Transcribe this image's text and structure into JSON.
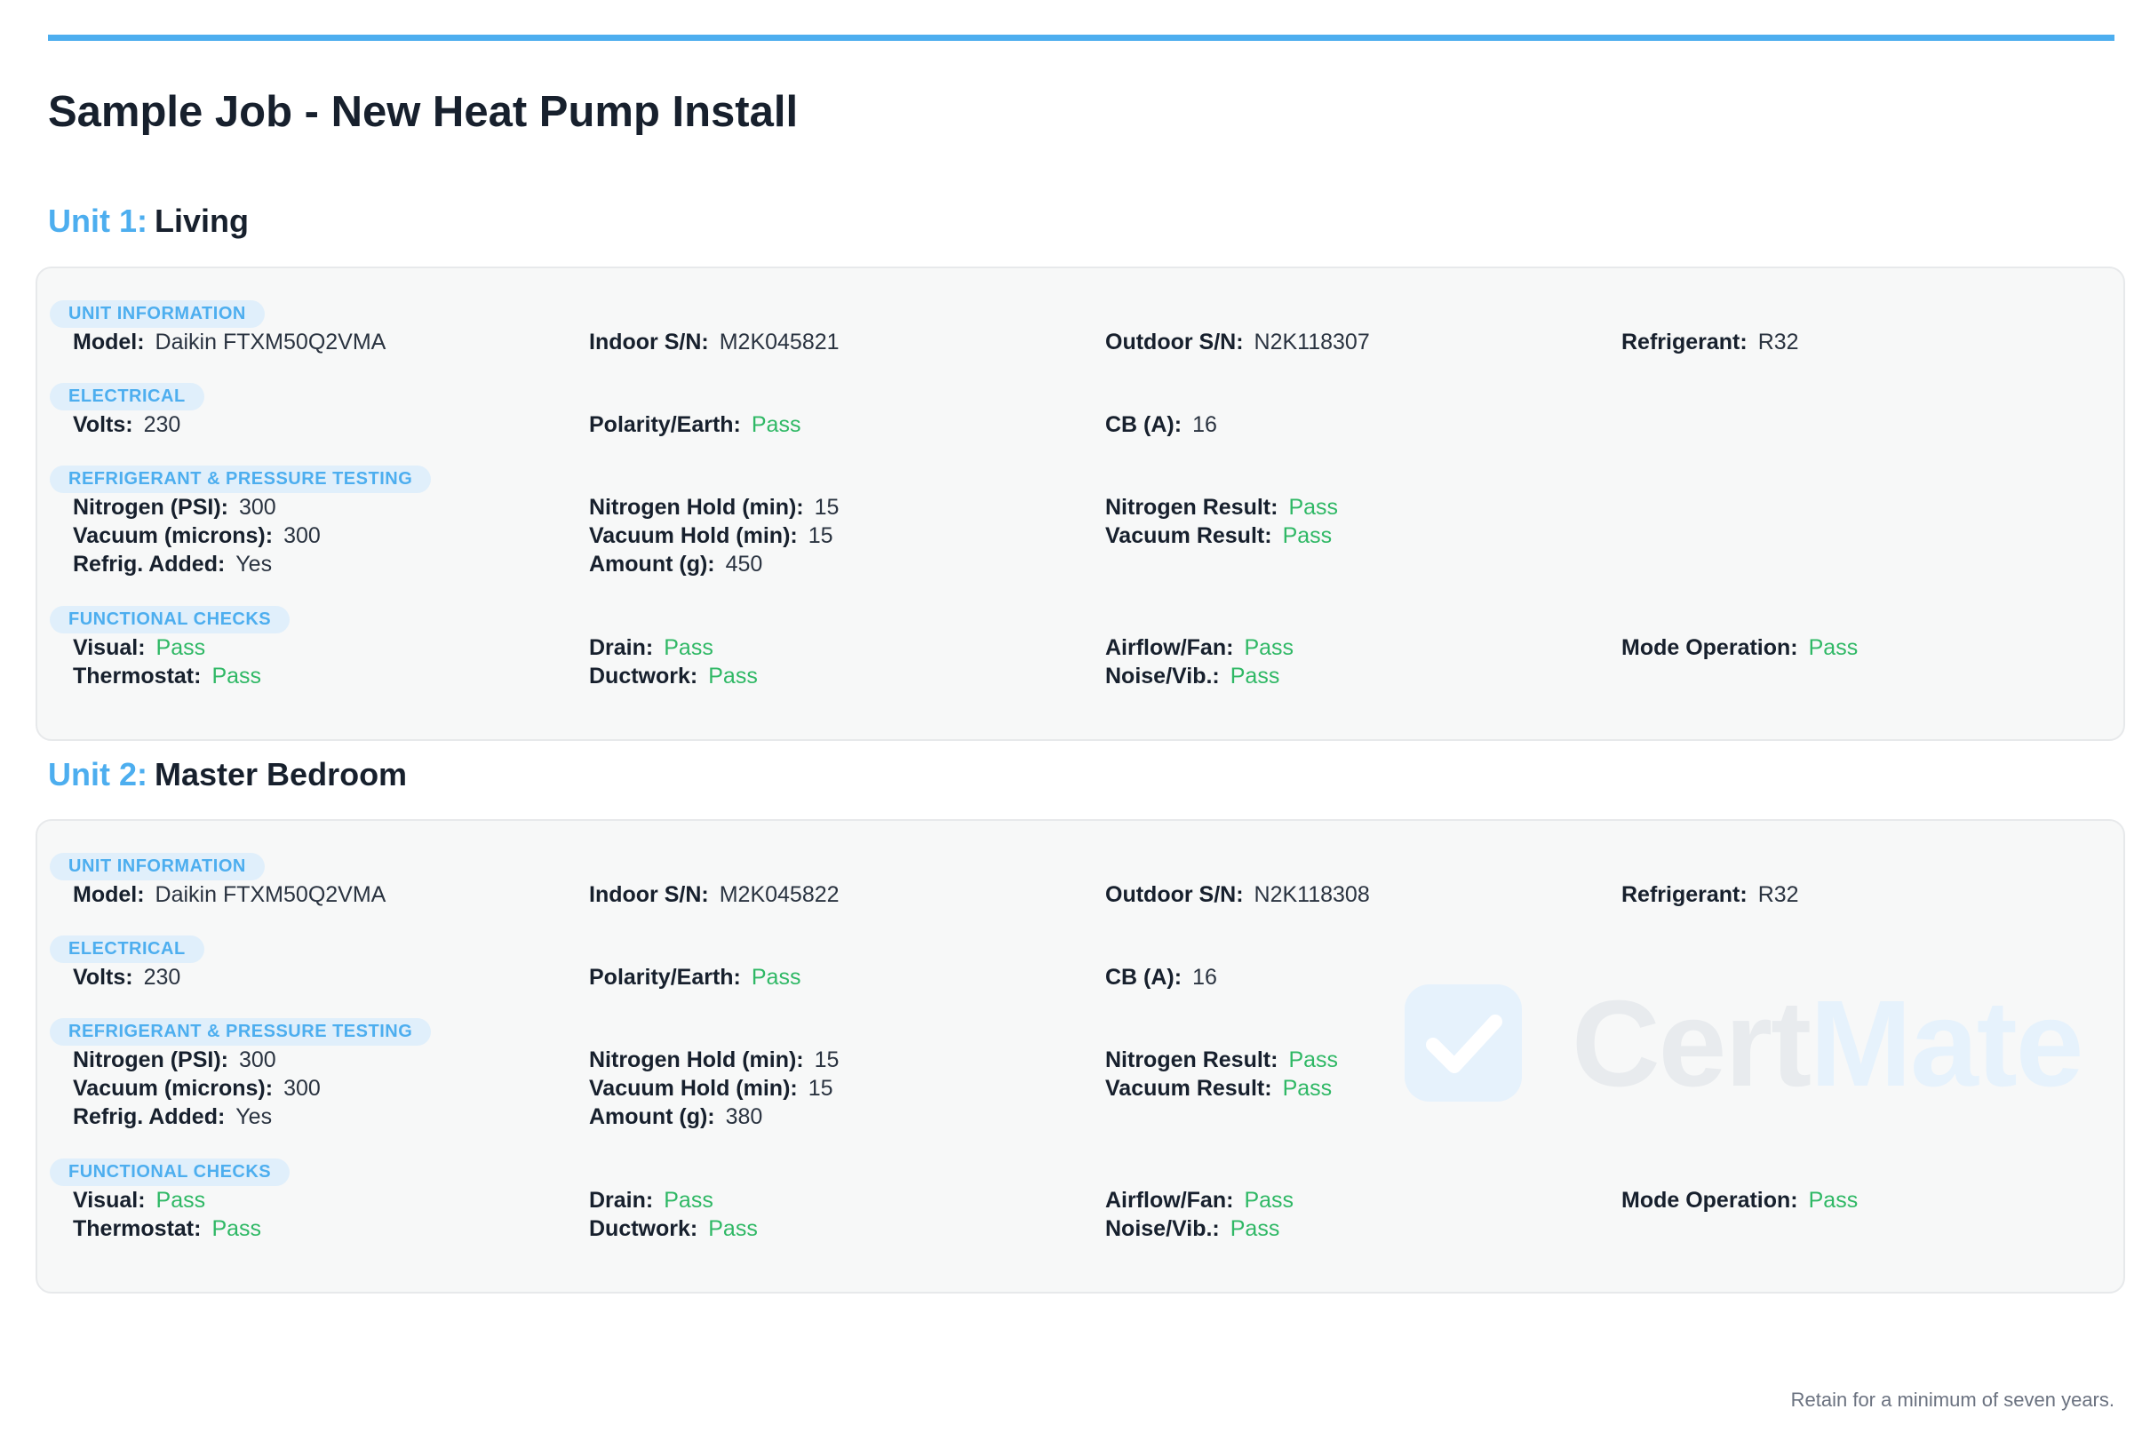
{
  "page": {
    "title": "Sample Job - New Heat Pump Install",
    "footer_note": "Retain for a minimum of seven years.",
    "watermark": {
      "cert": "Cert",
      "mate": "Mate",
      "icon": "check-badge-icon"
    }
  },
  "colors": {
    "accent": "#4daeef",
    "pass": "#2fb865",
    "pill_bg": "#e0effb",
    "card_bg": "#f7f8f8"
  },
  "section_titles": {
    "unit_info": "UNIT INFORMATION",
    "electrical": "ELECTRICAL",
    "refrigerant": "REFRIGERANT & PRESSURE TESTING",
    "functional": "FUNCTIONAL CHECKS"
  },
  "labels": {
    "model": "Model:",
    "indoor_sn": "Indoor S/N:",
    "outdoor_sn": "Outdoor S/N:",
    "refrigerant": "Refrigerant:",
    "volts": "Volts:",
    "polarity": "Polarity/Earth:",
    "cb": "CB (A):",
    "nitrogen_psi": "Nitrogen (PSI):",
    "vacuum_microns": "Vacuum (microns):",
    "refrig_added": "Refrig. Added:",
    "nitrogen_hold": "Nitrogen Hold (min):",
    "vacuum_hold": "Vacuum Hold (min):",
    "amount": "Amount (g):",
    "nitrogen_result": "Nitrogen Result:",
    "vacuum_result": "Vacuum Result:",
    "visual": "Visual:",
    "thermostat": "Thermostat:",
    "drain": "Drain:",
    "ductwork": "Ductwork:",
    "airflow": "Airflow/Fan:",
    "noise": "Noise/Vib.:",
    "mode_operation": "Mode Operation:"
  },
  "units": [
    {
      "label": "Unit 1:",
      "name": "Living",
      "model": "Daikin FTXM50Q2VMA",
      "indoor_sn": "M2K045821",
      "outdoor_sn": "N2K118307",
      "refrigerant": "R32",
      "volts": "230",
      "polarity": "Pass",
      "cb": "16",
      "nitrogen_psi": "300",
      "vacuum_microns": "300",
      "refrig_added": "Yes",
      "nitrogen_hold": "15",
      "vacuum_hold": "15",
      "amount": "450",
      "nitrogen_result": "Pass",
      "vacuum_result": "Pass",
      "visual": "Pass",
      "thermostat": "Pass",
      "drain": "Pass",
      "ductwork": "Pass",
      "airflow": "Pass",
      "noise": "Pass",
      "mode_operation": "Pass"
    },
    {
      "label": "Unit 2:",
      "name": "Master Bedroom",
      "model": "Daikin FTXM50Q2VMA",
      "indoor_sn": "M2K045822",
      "outdoor_sn": "N2K118308",
      "refrigerant": "R32",
      "volts": "230",
      "polarity": "Pass",
      "cb": "16",
      "nitrogen_psi": "300",
      "vacuum_microns": "300",
      "refrig_added": "Yes",
      "nitrogen_hold": "15",
      "vacuum_hold": "15",
      "amount": "380",
      "nitrogen_result": "Pass",
      "vacuum_result": "Pass",
      "visual": "Pass",
      "thermostat": "Pass",
      "drain": "Pass",
      "ductwork": "Pass",
      "airflow": "Pass",
      "noise": "Pass",
      "mode_operation": "Pass"
    }
  ]
}
